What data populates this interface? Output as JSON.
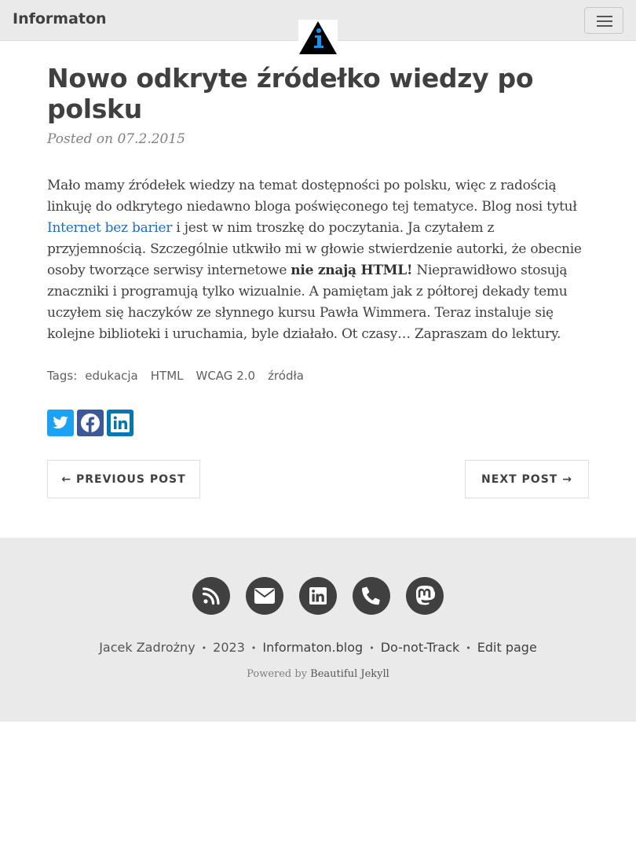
{
  "navbar": {
    "brand": "Informaton",
    "logo_icon": "info-triangle-logo",
    "menu_icon": "hamburger-menu-icon"
  },
  "post": {
    "title": "Nowo odkryte źródełko wiedzy po polsku",
    "meta": "Posted on 07.2.2015",
    "body": {
      "p1": "Mało mamy źródełek wiedzy na temat dostępności po polsku, więc z radością linkuję do odkrytego niedawno bloga poświęconego tej tematyce. Blog nosi tytuł ",
      "link": "Internet bez barier",
      "p2": " i jest w nim troszkę do poczytania. Ja czytałem z przyjemnością. Szczególnie utkwiło mi w głowie stwierdzenie autorki, że obecnie osoby tworzące serwisy internetowe ",
      "bold": "nie znają HTML!",
      "p3": " Nieprawidłowo stosują znaczniki i programują tylko wizualnie. A pamiętam jak z półtorej dekady temu uczyłem się haczyków ze słynnego kursu Pawła Wimmera. Teraz instaluje się kolejne biblioteki i uruchamia, byle działało. Ot czasy… Zapraszam do lektury."
    },
    "tags_label": "Tags:",
    "tags": [
      "edukacja",
      "HTML",
      "WCAG 2.0",
      "źródła"
    ]
  },
  "share": {
    "icons": [
      "twitter-icon",
      "facebook-icon",
      "linkedin-icon"
    ],
    "colors": {
      "twitter": "#1da1f2",
      "facebook": "#3b5998",
      "linkedin": "#0077b5"
    }
  },
  "pager": {
    "previous": "← PREVIOUS POST",
    "next": "NEXT POST →"
  },
  "footer": {
    "icons": [
      "rss-icon",
      "email-icon",
      "linkedin-icon",
      "phone-icon",
      "mastodon-icon"
    ],
    "author": "Jacek Zadrożny",
    "year": "2023",
    "site": "Informaton.blog",
    "dnt": "Do-not-Track",
    "edit": "Edit page",
    "separator": "•",
    "powered_prefix": "Powered by ",
    "powered_link": "Beautiful Jekyll"
  }
}
